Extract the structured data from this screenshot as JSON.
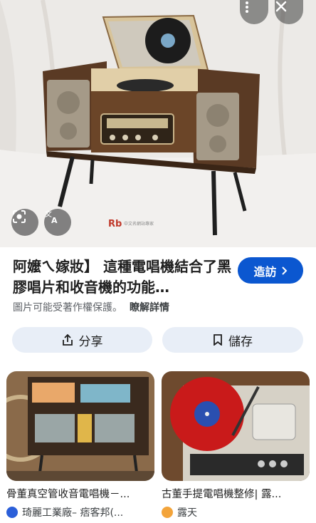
{
  "hero": {
    "watermark_logo": "Rb",
    "watermark_text": "中文名網站專家"
  },
  "result": {
    "title": "阿嬤ㄟ嫁妝】 這種電唱機結合了黑膠唱片和收音機的功能…",
    "visit_label": "造訪",
    "copyright_notice": "圖片可能受著作權保護。",
    "learn_more": "瞭解詳情"
  },
  "actions": {
    "share_label": "分享",
    "save_label": "儲存"
  },
  "related": [
    {
      "title": "骨董真空管收音電唱機－...",
      "source": "琦麗工業廠– 痞客邦(...",
      "source_icon_color": "#2b5fd9"
    },
    {
      "title": "古董手提電唱機整修| 露...",
      "source": "露天",
      "source_icon_color": "#f3a43b"
    }
  ],
  "colors": {
    "accent": "#0b57d0",
    "button_bg": "#e8eef7"
  },
  "icons": [
    "more-vert-icon",
    "close-icon",
    "lens-icon",
    "translate-icon",
    "share-icon",
    "bookmark-icon",
    "chevron-right-icon"
  ]
}
